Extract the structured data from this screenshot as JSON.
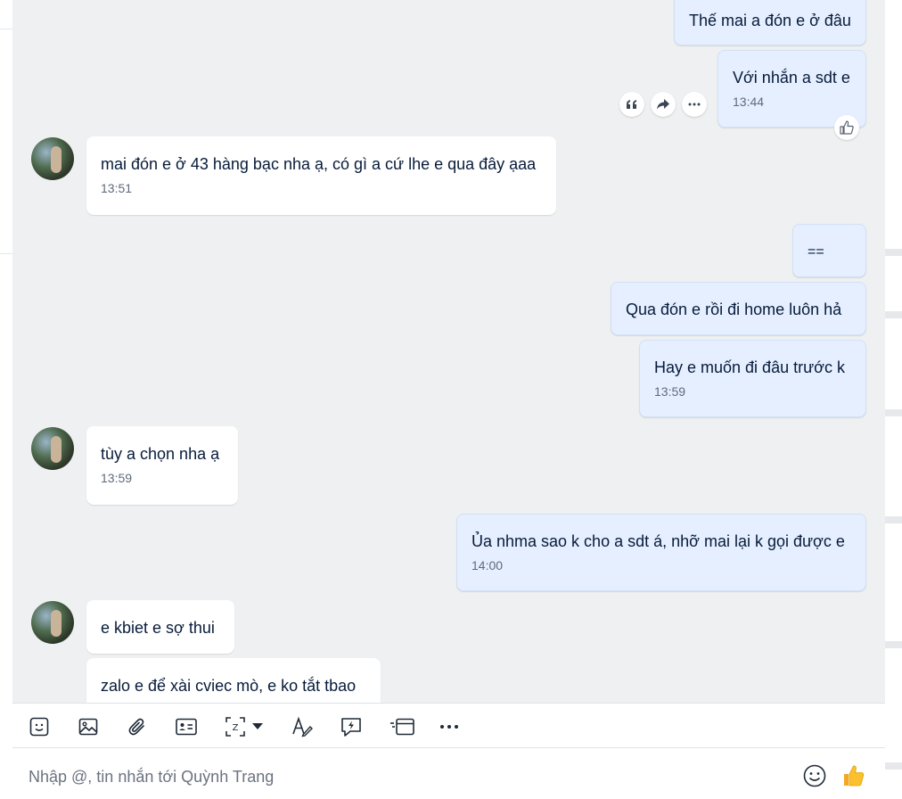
{
  "chat": {
    "messages": [
      {
        "side": "me",
        "text": "Thế mai a đón e ở đâu",
        "time": ""
      },
      {
        "side": "me",
        "text": "Với nhắn a sdt e",
        "time": "13:44"
      },
      {
        "side": "them",
        "text": "mai đón e ở 43 hàng bạc nha ạ, có gì a cứ lhe e qua đây ạaa",
        "time": "13:51"
      },
      {
        "side": "me",
        "text": "==",
        "time": ""
      },
      {
        "side": "me",
        "text": "Qua đón e rồi đi home luôn hả",
        "time": ""
      },
      {
        "side": "me",
        "text": "Hay e muốn đi đâu trước k",
        "time": "13:59"
      },
      {
        "side": "them",
        "text": "tùy a chọn nha ạ",
        "time": "13:59"
      },
      {
        "side": "me",
        "text": "Ủa nhma sao k cho a sdt á, nhỡ mai lại k gọi được e",
        "time": "14:00"
      },
      {
        "side": "them",
        "text": "e kbiet e sợ thui",
        "time": ""
      },
      {
        "side": "them",
        "text": "zalo e để xài cviec mò, e ko tắt tbao",
        "time": ""
      }
    ],
    "hover_actions": [
      "quote-icon",
      "forward-icon",
      "more-icon"
    ],
    "reaction_icon": "thumbs-up-outline-icon"
  },
  "toolbar": {
    "icons": [
      "sticker-icon",
      "image-icon",
      "attachment-icon",
      "contact-card-icon",
      "screenshot-icon",
      "dropdown-caret-icon",
      "text-format-icon",
      "quick-message-icon",
      "card-message-icon",
      "more-options-icon"
    ],
    "more_label": "···"
  },
  "composer": {
    "placeholder": "Nhập @, tin nhắn tới Quỳnh Trang",
    "emoji_icon": "emoji-icon",
    "like_icon": "thumbs-up-emoji-icon",
    "like_emoji": "👍"
  },
  "colors": {
    "chat_background": "#eef0f1",
    "my_bubble": "#e5efff",
    "their_bubble": "#ffffff",
    "text": "#081b3a"
  }
}
